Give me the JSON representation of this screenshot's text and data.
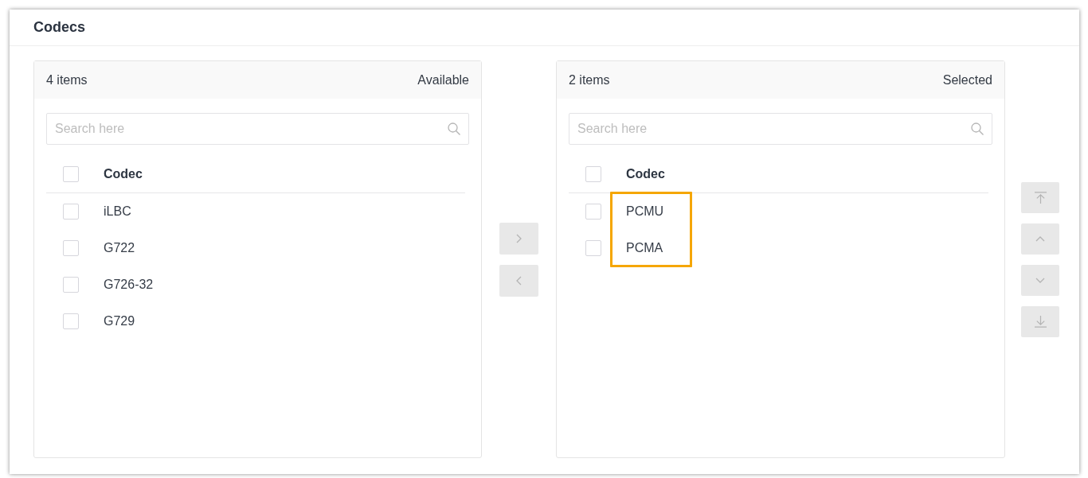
{
  "card": {
    "title": "Codecs"
  },
  "transfer": {
    "panels": [
      {
        "count": "4 items",
        "title": "Available",
        "search": {
          "placeholder": "Search here"
        },
        "column": "Codec",
        "select_all_checked": false,
        "items": [
          {
            "name": "iLBC",
            "checked": false,
            "highlighted": false
          },
          {
            "name": "G722",
            "checked": false,
            "highlighted": false
          },
          {
            "name": "G726-32",
            "checked": false,
            "highlighted": false
          },
          {
            "name": "G729",
            "checked": false,
            "highlighted": false
          }
        ]
      },
      {
        "count": "2 items",
        "title": "Selected",
        "search": {
          "placeholder": "Search here"
        },
        "column": "Codec",
        "select_all_checked": false,
        "items": [
          {
            "name": "PCMU",
            "checked": false,
            "highlighted": true
          },
          {
            "name": "PCMA",
            "checked": false,
            "highlighted": true
          }
        ]
      }
    ],
    "move_buttons": [
      {
        "kind": "right",
        "disabled": true
      },
      {
        "kind": "left",
        "disabled": true
      }
    ],
    "order_buttons": [
      {
        "kind": "top",
        "disabled": true
      },
      {
        "kind": "up",
        "disabled": true
      },
      {
        "kind": "down",
        "disabled": true
      },
      {
        "kind": "bottom",
        "disabled": true
      }
    ]
  }
}
